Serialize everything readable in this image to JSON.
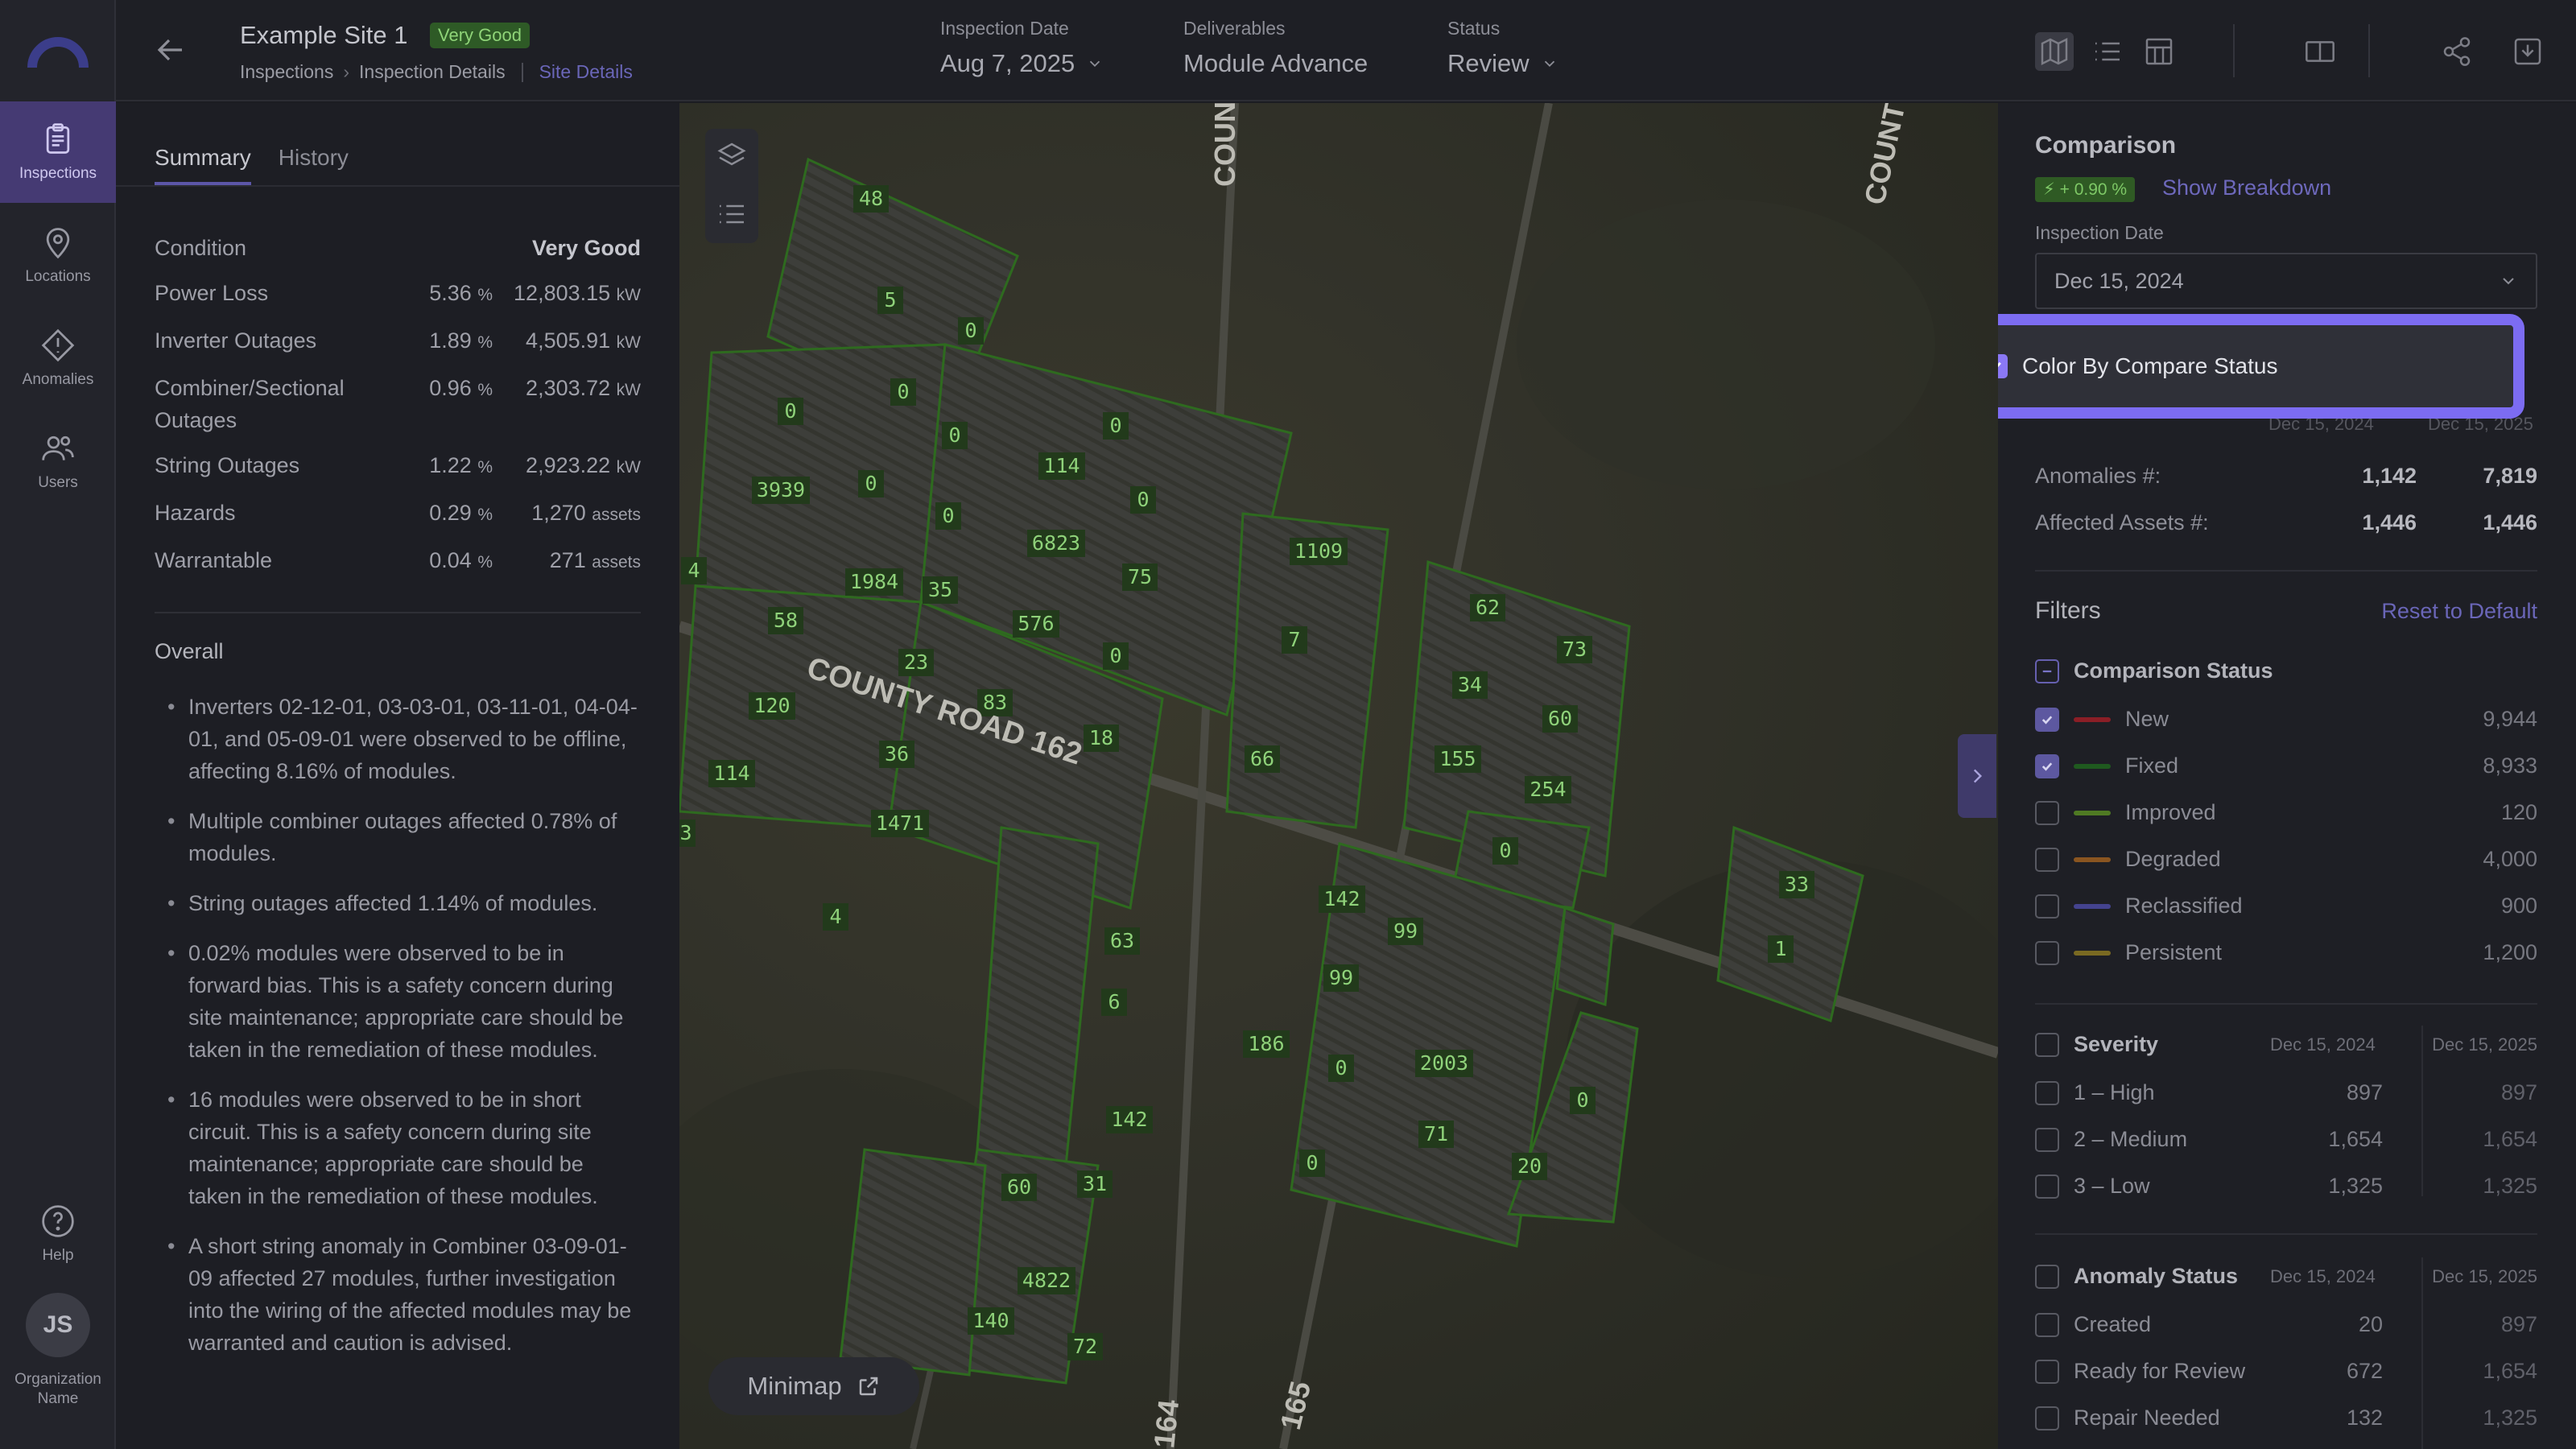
{
  "nav": {
    "items": [
      {
        "label": "Inspections",
        "icon": "clipboard-icon",
        "active": true
      },
      {
        "label": "Locations",
        "icon": "location-pin-icon",
        "active": false
      },
      {
        "label": "Anomalies",
        "icon": "warning-diamond-icon",
        "active": false
      },
      {
        "label": "Users",
        "icon": "users-icon",
        "active": false
      }
    ],
    "help_label": "Help",
    "avatar_initials": "JS",
    "org_name": "Organization Name"
  },
  "header": {
    "site_title": "Example Site 1",
    "condition_badge": "Very Good",
    "breadcrumbs": [
      "Inspections",
      "Inspection Details"
    ],
    "site_details_link": "Site Details",
    "inspection_date_label": "Inspection Date",
    "inspection_date_value": "Aug 7, 2025",
    "deliverables_label": "Deliverables",
    "deliverables_value": "Module Advance",
    "status_label": "Status",
    "status_value": "Review"
  },
  "summary": {
    "tabs": [
      "Summary",
      "History"
    ],
    "condition_label": "Condition",
    "condition_value": "Very Good",
    "metrics": [
      {
        "label": "Power Loss",
        "pct": "5.36",
        "value": "12,803.15",
        "unit": "kW"
      },
      {
        "label": "Inverter Outages",
        "pct": "1.89",
        "value": "4,505.91",
        "unit": "kW"
      },
      {
        "label": "Combiner/Sectional Outages",
        "pct": "0.96",
        "value": "2,303.72",
        "unit": "kW"
      },
      {
        "label": "String Outages",
        "pct": "1.22",
        "value": "2,923.22",
        "unit": "kW"
      },
      {
        "label": "Hazards",
        "pct": "0.29",
        "value": "1,270",
        "unit": "assets"
      },
      {
        "label": "Warrantable",
        "pct": "0.04",
        "value": "271",
        "unit": "assets"
      }
    ],
    "pct_symbol": "%",
    "overall_title": "Overall",
    "bullets": [
      "Inverters 02-12-01, 03-03-01, 03-11-01, 04-04-01, and 05-09-01 were observed to be offline, affecting 8.16% of modules.",
      "Multiple combiner outages affected 0.78% of modules.",
      "String outages affected 1.14% of modules.",
      "0.02% modules were observed to be in forward bias. This is a safety concern during site maintenance; appropriate care should be taken in the remediation of these modules.",
      "16 modules were observed to be in short circuit. This is a safety concern during site maintenance; appropriate care should be taken in the remediation of these modules.",
      "A short string anomaly in Combiner 03-09-01-09 affected 27 modules, further investigation into the wiring of the affected modules may be warranted and caution is advised."
    ]
  },
  "map": {
    "road_labels": [
      "COUNTY ROAD 162",
      "COUN",
      "COUNT",
      "164",
      "165"
    ],
    "block_counts": [
      "48",
      "5",
      "0",
      "0",
      "0",
      "0",
      "0",
      "114",
      "0",
      "0",
      "3939",
      "0",
      "6823",
      "75",
      "1984",
      "35",
      "4",
      "58",
      "576",
      "0",
      "23",
      "120",
      "83",
      "18",
      "36",
      "114",
      "1471",
      "3",
      "4",
      "1109",
      "7",
      "66",
      "62",
      "73",
      "34",
      "60",
      "155",
      "254",
      "0",
      "142",
      "99",
      "99",
      "33",
      "1",
      "63",
      "6",
      "186",
      "0",
      "2003",
      "0",
      "71",
      "142",
      "20",
      "0",
      "60",
      "31",
      "4822",
      "140",
      "72"
    ],
    "minimap_label": "Minimap"
  },
  "comparison": {
    "title": "Comparison",
    "delta": "+ 0.90 %",
    "show_breakdown": "Show Breakdown",
    "inspection_date_label": "Inspection Date",
    "inspection_date_value": "Dec 15, 2024",
    "color_by_label": "Color By Compare Status",
    "col_date_1": "Dec 15, 2024",
    "col_date_2": "Dec 15, 2025",
    "anomalies_label": "Anomalies #:",
    "anomalies_1": "1,142",
    "anomalies_2": "7,819",
    "assets_label": "Affected Assets #:",
    "assets_1": "1,446",
    "assets_2": "1,446"
  },
  "filters": {
    "title": "Filters",
    "reset_label": "Reset to Default",
    "comparison_status": {
      "title": "Comparison Status",
      "items": [
        {
          "label": "New",
          "value": "9,944",
          "color": "#8b1e26",
          "checked": true
        },
        {
          "label": "Fixed",
          "value": "8,933",
          "color": "#1f5a1f",
          "checked": true
        },
        {
          "label": "Improved",
          "value": "120",
          "color": "#4f7a23",
          "checked": false
        },
        {
          "label": "Degraded",
          "value": "4,000",
          "color": "#8a5520",
          "checked": false
        },
        {
          "label": "Reclassified",
          "value": "900",
          "color": "#44438f",
          "checked": false
        },
        {
          "label": "Persistent",
          "value": "1,200",
          "color": "#7a6a22",
          "checked": false
        }
      ]
    },
    "severity": {
      "title": "Severity",
      "date_1": "Dec 15, 2024",
      "date_2": "Dec 15, 2025",
      "items": [
        {
          "label": "1 – High",
          "v1": "897",
          "v2": "897"
        },
        {
          "label": "2 – Medium",
          "v1": "1,654",
          "v2": "1,654"
        },
        {
          "label": "3 – Low",
          "v1": "1,325",
          "v2": "1,325"
        }
      ]
    },
    "anomaly_status": {
      "title": "Anomaly Status",
      "date_1": "Dec 15, 2024",
      "date_2": "Dec 15, 2025",
      "items": [
        {
          "label": "Created",
          "v1": "20",
          "v2": "897"
        },
        {
          "label": "Ready for Review",
          "v1": "672",
          "v2": "1,654"
        },
        {
          "label": "Repair Needed",
          "v1": "132",
          "v2": "1,325"
        }
      ]
    }
  }
}
